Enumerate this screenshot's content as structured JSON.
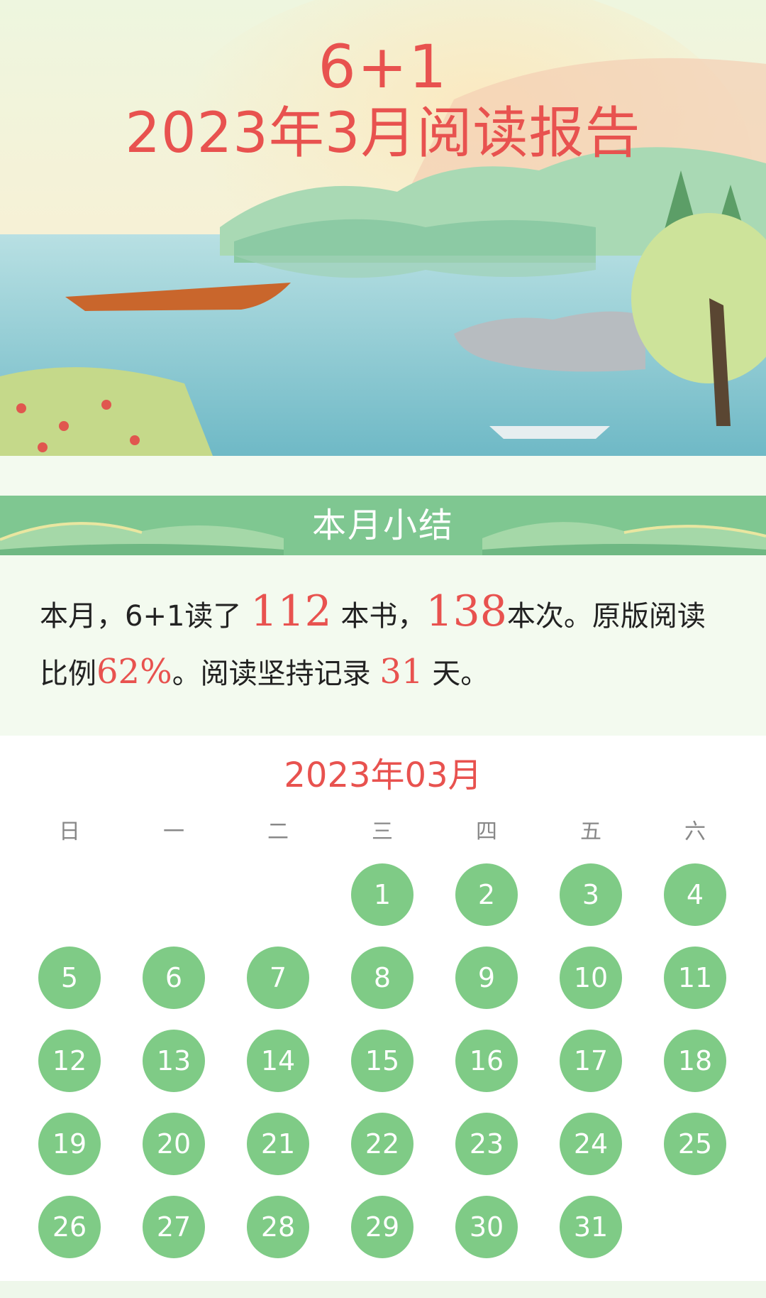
{
  "hero": {
    "title_line1": "6+1",
    "title_line2": "2023年3月阅读报告"
  },
  "section": {
    "title": "本月小结"
  },
  "summary": {
    "p1": "本月，6+1读了",
    "books": "112",
    "p2": "本书，",
    "times": "138",
    "p3": "本次。原版阅读比例",
    "original_ratio": "62%",
    "p4": "。阅读坚持记录",
    "streak_days": "31",
    "p5": "天。"
  },
  "calendar": {
    "title": "2023年03月",
    "weekdays": [
      "日",
      "一",
      "二",
      "三",
      "四",
      "五",
      "六"
    ],
    "first_weekday_index": 3,
    "days_in_month": 31,
    "read_days": [
      "1",
      "2",
      "3",
      "4",
      "5",
      "6",
      "7",
      "8",
      "9",
      "10",
      "11",
      "12",
      "13",
      "14",
      "15",
      "16",
      "17",
      "18",
      "19",
      "20",
      "21",
      "22",
      "23",
      "24",
      "25",
      "26",
      "27",
      "28",
      "29",
      "30",
      "31"
    ]
  },
  "colors": {
    "accent_red": "#e8524f",
    "read_day_green": "#7fcb86",
    "banner_green": "#7fc791",
    "page_bg": "#f3faef"
  }
}
